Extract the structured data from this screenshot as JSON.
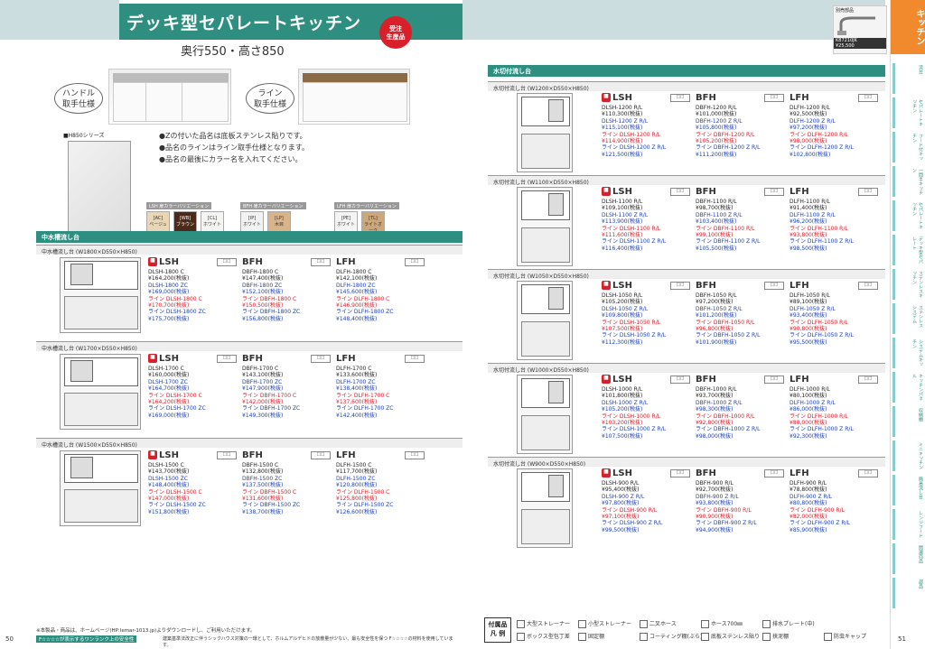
{
  "header": {
    "title": "デッキ型セパレートキッチン",
    "subtitle": "奥行550・高さ850",
    "badge_line1": "受注",
    "badge_line2": "生産品",
    "faucet_label": "別売部品",
    "faucet_price": "¥25,500",
    "faucet_code": "K87210JK"
  },
  "tabs": [
    {
      "label": "キッチン",
      "main": true
    },
    {
      "label": "流台"
    },
    {
      "label": "セパレートキッチン"
    },
    {
      "label": "フード付キッチン"
    },
    {
      "label": "一間半キッチン"
    },
    {
      "label": "セパレートキッチン"
    },
    {
      "label": "デッキ型セパレート"
    },
    {
      "label": "ステンレスキッチン"
    },
    {
      "label": "ステンレス システム"
    },
    {
      "label": "システムキッチン"
    },
    {
      "label": "キッチンパネル"
    },
    {
      "label": "収納棚"
    },
    {
      "label": "ミニキッチン"
    },
    {
      "label": "簡易流し台"
    },
    {
      "label": "レンジフード"
    },
    {
      "label": "関連商品"
    },
    {
      "label": "部品"
    }
  ],
  "callouts": {
    "handle": "ハンドル\n取手仕様",
    "line": "ライン\n取手仕様"
  },
  "notes": [
    "●Zの付いた品名は底板ステンレス貼りです。",
    "●品名のラインはライン取手仕様となります。",
    "●品名の最後にカラー名を入れてください。"
  ],
  "series_label": "■H850シリーズ",
  "color_groups": [
    {
      "title": "LSH 扉カラーバリエーション",
      "swatches": [
        {
          "code": "[AC]",
          "name": "ベージュ",
          "color": "#e8d6b4"
        },
        {
          "code": "[WB]",
          "name": "ブラウン",
          "color": "#4b2a1a"
        },
        {
          "code": "[CL]",
          "name": "ホワイト",
          "color": "#f4f4f2"
        }
      ]
    },
    {
      "title": "BFH 扉カラーバリエーション",
      "swatches": [
        {
          "code": "[IP]",
          "name": "ホワイト",
          "color": "#f2f2f2"
        },
        {
          "code": "[LP]",
          "name": "木目",
          "color": "#d9b48a"
        }
      ]
    },
    {
      "title": "LFH 扉カラーバリエーション",
      "swatches": [
        {
          "code": "[PE]",
          "name": "ホワイト",
          "color": "#f4f4f4"
        },
        {
          "code": "[TL]",
          "name": "ライトオーク",
          "color": "#cda77a"
        }
      ]
    }
  ],
  "left_section": "中水槽流し台",
  "right_section": "水切付流し台",
  "left_groups": [
    {
      "sub": "中水槽流し台 (W1800×D550×H850)",
      "lsh": [
        "DLSH-1800 C",
        "¥164,200(税抜)",
        "DLSH-1800 ZC",
        "¥169,000(税抜)",
        "ライン DLSH-1800 C",
        "¥170,700(税抜)",
        "ライン DLSH-1800 ZC",
        "¥175,700(税抜)"
      ],
      "bfh": [
        "DBFH-1800 C",
        "¥147,400(税抜)",
        "DBFH-1800 ZC",
        "¥152,100(税抜)",
        "ライン DBFH-1800 C",
        "¥150,500(税抜)",
        "ライン DBFH-1800 ZC",
        "¥156,800(税抜)"
      ],
      "lfh": [
        "DLFH-1800 C",
        "¥142,100(税抜)",
        "DLFH-1800 ZC",
        "¥145,600(税抜)",
        "ライン DLFH-1800 C",
        "¥146,900(税抜)",
        "ライン DLFH-1800 ZC",
        "¥148,400(税抜)"
      ]
    },
    {
      "sub": "中水槽流し台 (W1700×D550×H850)",
      "lsh": [
        "DLSH-1700 C",
        "¥160,000(税抜)",
        "DLSH-1700 ZC",
        "¥164,700(税抜)",
        "ライン DLSH-1700 C",
        "¥164,200(税抜)",
        "ライン DLSH-1700 ZC",
        "¥169,000(税抜)"
      ],
      "bfh": [
        "DBFH-1700 C",
        "¥143,100(税抜)",
        "DBFH-1700 ZC",
        "¥147,900(税抜)",
        "ライン DBFH-1700 C",
        "¥142,000(税抜)",
        "ライン DBFH-1700 ZC",
        "¥149,300(税抜)"
      ],
      "lfh": [
        "DLFH-1700 C",
        "¥133,600(税抜)",
        "DLFH-1700 ZC",
        "¥138,400(税抜)",
        "ライン DLFH-1700 C",
        "¥137,600(税抜)",
        "ライン DLFH-1700 ZC",
        "¥142,400(税抜)"
      ]
    },
    {
      "sub": "中水槽流し台 (W1500×D550×H850)",
      "lsh": [
        "DLSH-1500 C",
        "¥143,700(税抜)",
        "DLSH-1500 ZC",
        "¥148,400(税抜)",
        "ライン DLSH-1500 C",
        "¥147,000(税抜)",
        "ライン DLSH-1500 ZC",
        "¥151,800(税抜)"
      ],
      "bfh": [
        "DBFH-1500 C",
        "¥132,800(税抜)",
        "DBFH-1500 ZC",
        "¥137,500(税抜)",
        "ライン DBFH-1500 C",
        "¥131,600(税抜)",
        "ライン DBFH-1500 ZC",
        "¥138,700(税抜)"
      ],
      "lfh": [
        "DLFH-1500 C",
        "¥117,700(税抜)",
        "DLFH-1500 ZC",
        "¥120,800(税抜)",
        "ライン DLFH-1500 C",
        "¥125,800(税抜)",
        "ライン DLFH-1500 ZC",
        "¥126,600(税抜)"
      ]
    }
  ],
  "right_groups": [
    {
      "sub": "水切付流し台 (W1200×D550×H850)",
      "lsh": [
        "DLSH-1200 R/L",
        "¥110,300(税抜)",
        "DLSH-1200 Z R/L",
        "¥115,100(税抜)",
        "ライン DLSH-1200 R/L",
        "¥114,900(税抜)",
        "ライン DLSH-1200 Z R/L",
        "¥121,500(税抜)"
      ],
      "bfh": [
        "DBFH-1200 R/L",
        "¥101,000(税抜)",
        "DBFH-1200 Z R/L",
        "¥105,800(税抜)",
        "ライン DBFH-1200 R/L",
        "¥105,200(税抜)",
        "ライン DBFH-1200 Z R/L",
        "¥111,200(税抜)"
      ],
      "lfh": [
        "DLFH-1200 R/L",
        "¥92,500(税抜)",
        "DLFH-1200 Z R/L",
        "¥97,200(税抜)",
        "ライン DLFH-1200 R/L",
        "¥98,000(税抜)",
        "ライン DLFH-1200 Z R/L",
        "¥102,800(税抜)"
      ]
    },
    {
      "sub": "水切付流し台 (W1100×D550×H850)",
      "lsh": [
        "DLSH-1100 R/L",
        "¥109,100(税抜)",
        "DLSH-1100 Z R/L",
        "¥113,900(税抜)",
        "ライン DLSH-1100 R/L",
        "¥111,600(税抜)",
        "ライン DLSH-1100 Z R/L",
        "¥116,400(税抜)"
      ],
      "bfh": [
        "DBFH-1100 R/L",
        "¥98,700(税抜)",
        "DBFH-1100 Z R/L",
        "¥103,400(税抜)",
        "ライン DBFH-1100 R/L",
        "¥99,100(税抜)",
        "ライン DBFH-1100 Z R/L",
        "¥105,500(税抜)"
      ],
      "lfh": [
        "DLFH-1100 R/L",
        "¥91,400(税抜)",
        "DLFH-1100 Z R/L",
        "¥96,200(税抜)",
        "ライン DLFH-1100 R/L",
        "¥93,800(税抜)",
        "ライン DLFH-1100 Z R/L",
        "¥98,500(税抜)"
      ]
    },
    {
      "sub": "水切付流し台 (W1050×D550×H850)",
      "lsh": [
        "DLSH-1050 R/L",
        "¥105,200(税抜)",
        "DLSH-1050 Z R/L",
        "¥109,800(税抜)",
        "ライン DLSH-1050 R/L",
        "¥107,500(税抜)",
        "ライン DLSH-1050 Z R/L",
        "¥112,300(税抜)"
      ],
      "bfh": [
        "DBFH-1050 R/L",
        "¥97,200(税抜)",
        "DBFH-1050 Z R/L",
        "¥101,200(税抜)",
        "ライン DBFH-1050 R/L",
        "¥96,800(税抜)",
        "ライン DBFH-1050 Z R/L",
        "¥101,900(税抜)"
      ],
      "lfh": [
        "DLFH-1050 R/L",
        "¥89,100(税抜)",
        "DLFH-1050 Z R/L",
        "¥93,400(税抜)",
        "ライン DLFH-1050 R/L",
        "¥90,800(税抜)",
        "ライン DLFH-1050 Z R/L",
        "¥95,500(税抜)"
      ]
    },
    {
      "sub": "水切付流し台 (W1000×D550×H850)",
      "lsh": [
        "DLSH-1000 R/L",
        "¥101,800(税抜)",
        "DLSH-1000 Z R/L",
        "¥105,200(税抜)",
        "ライン DLSH-1000 R/L",
        "¥103,200(税抜)",
        "ライン DLSH-1000 Z R/L",
        "¥107,500(税抜)"
      ],
      "bfh": [
        "DBFH-1000 R/L",
        "¥93,700(税抜)",
        "DBFH-1000 Z R/L",
        "¥98,300(税抜)",
        "ライン DBFH-1000 R/L",
        "¥92,800(税抜)",
        "ライン DBFH-1000 Z R/L",
        "¥98,000(税抜)"
      ],
      "lfh": [
        "DLFH-1000 R/L",
        "¥80,100(税抜)",
        "DLFH-1000 Z R/L",
        "¥86,000(税抜)",
        "ライン DLFH-1000 R/L",
        "¥88,000(税抜)",
        "ライン DLFH-1000 Z R/L",
        "¥92,300(税抜)"
      ]
    },
    {
      "sub": "水切付流し台 (W900×D550×H850)",
      "lsh": [
        "DLSH-900 R/L",
        "¥95,400(税抜)",
        "DLSH-900 Z R/L",
        "¥97,800(税抜)",
        "ライン DLSH-900 R/L",
        "¥97,100(税抜)",
        "ライン DLSH-900 Z R/L",
        "¥99,500(税抜)"
      ],
      "bfh": [
        "DBFH-900 R/L",
        "¥92,700(税抜)",
        "DBFH-900 Z R/L",
        "¥93,800(税抜)",
        "ライン DBFH-900 R/L",
        "¥90,900(税抜)",
        "ライン DBFH-900 Z R/L",
        "¥94,900(税抜)"
      ],
      "lfh": [
        "DLFH-900 R/L",
        "¥78,800(税抜)",
        "DLFH-900 Z R/L",
        "¥80,800(税抜)",
        "ライン DLFH-900 R/L",
        "¥82,000(税抜)",
        "ライン DLFH-900 Z R/L",
        "¥85,900(税抜)"
      ]
    }
  ],
  "brand_names": {
    "lsh": "LSH",
    "bfh": "BFH",
    "lfh": "LFH",
    "ico": "☐☐"
  },
  "legend": {
    "title": "付属品\n凡 例",
    "items": [
      "大型ストレーナー",
      "小型ストレーナー",
      "二叉ホース",
      "ホース700㎜",
      "排水プレート(中)",
      "ボックス型包丁差",
      "固定棚",
      "コーティング棚(ぶら)",
      "底板ステンレス貼り",
      "挟泥棚",
      "防虫キャップ"
    ]
  },
  "footer": {
    "line1": "※本製品・商品は、ホームページ(HP:lemar-1013.jp)よりダウンロードし、ご利用いただけます。",
    "line2": "F☆☆☆☆が表示するワンランク上の安全性",
    "line3": "建築基準法改正に伴うシックハウス対策の一環として、ホルムアルデヒドの放散量が少ない、最も安全性を保つ F☆☆☆☆の材料を使用しています。"
  },
  "pages": {
    "left": "50",
    "right": "51"
  }
}
